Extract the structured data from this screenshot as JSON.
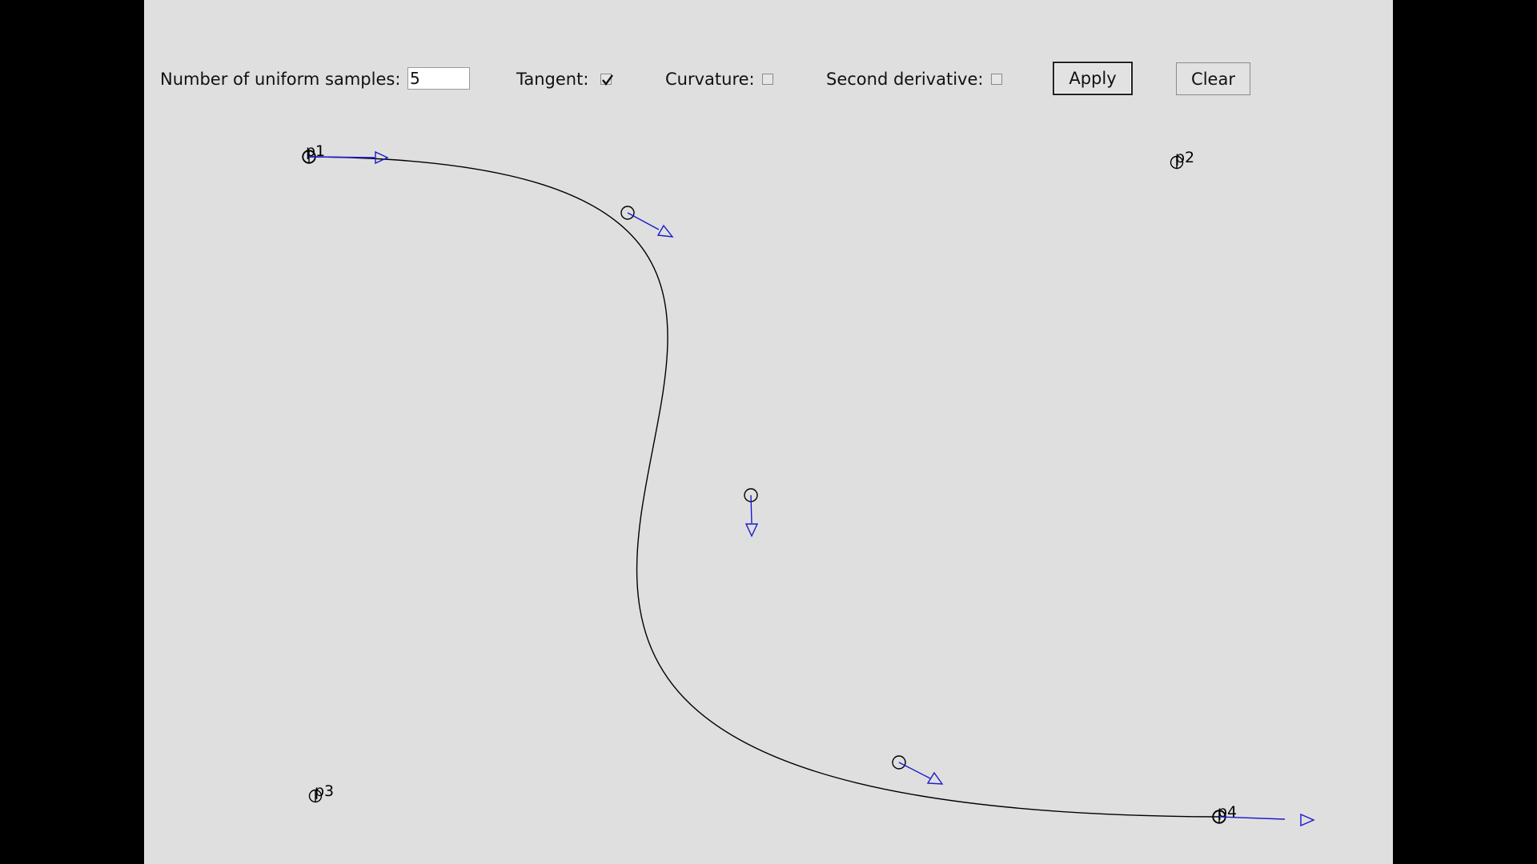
{
  "toolbar": {
    "samples_label": "Number of uniform samples:",
    "samples_value": "5",
    "tangent_label": "Tangent:",
    "tangent_checked": true,
    "curvature_label": "Curvature:",
    "curvature_checked": false,
    "second_derivative_label": "Second derivative:",
    "second_derivative_checked": false,
    "apply_label": "Apply",
    "clear_label": "Clear"
  },
  "control_points": [
    {
      "label": "p1"
    },
    {
      "label": "p2"
    },
    {
      "label": "p3"
    },
    {
      "label": "p4"
    }
  ],
  "colors": {
    "curve": "#000000",
    "tangent_arrow": "#1a1acc",
    "canvas_background": "#dfdfdf"
  }
}
